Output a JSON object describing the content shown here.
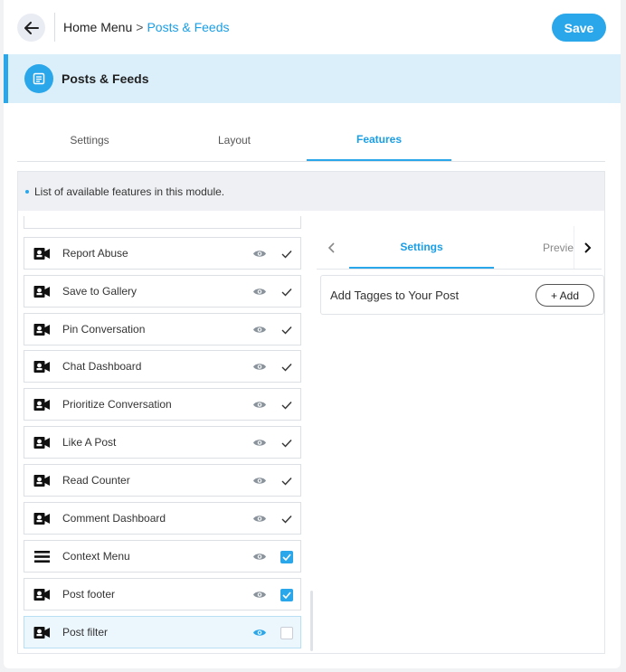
{
  "header": {
    "breadcrumb_home": "Home Menu",
    "breadcrumb_sep": ">",
    "breadcrumb_current": "Posts & Feeds",
    "save_label": "Save"
  },
  "module": {
    "title": "Posts & Feeds",
    "icon": "document-icon"
  },
  "tabs": [
    {
      "label": "Settings",
      "active": false
    },
    {
      "label": "Layout",
      "active": false
    },
    {
      "label": "Features",
      "active": true
    }
  ],
  "info_text": "List of available features in this module.",
  "features": [
    {
      "label": "Report Abuse",
      "icon": "video-icon",
      "visible": true,
      "state": "check"
    },
    {
      "label": "Save to Gallery",
      "icon": "video-icon",
      "visible": true,
      "state": "check"
    },
    {
      "label": "Pin Conversation",
      "icon": "video-icon",
      "visible": true,
      "state": "check"
    },
    {
      "label": "Chat Dashboard",
      "icon": "video-icon",
      "visible": true,
      "state": "check"
    },
    {
      "label": "Prioritize Conversation",
      "icon": "video-icon",
      "visible": true,
      "state": "check"
    },
    {
      "label": "Like A Post",
      "icon": "video-icon",
      "visible": true,
      "state": "check"
    },
    {
      "label": "Read Counter",
      "icon": "video-icon",
      "visible": true,
      "state": "check"
    },
    {
      "label": "Comment Dashboard",
      "icon": "video-icon",
      "visible": true,
      "state": "check"
    },
    {
      "label": "Context Menu",
      "icon": "menu-icon",
      "visible": true,
      "state": "checked"
    },
    {
      "label": "Post footer",
      "icon": "video-icon",
      "visible": true,
      "state": "checked"
    },
    {
      "label": "Post filter",
      "icon": "video-icon",
      "visible": true,
      "state": "unchecked",
      "highlighted": true
    }
  ],
  "right_panel": {
    "tabs": [
      {
        "label": "Settings",
        "active": true
      },
      {
        "label": "Previe",
        "active": false
      }
    ],
    "setting_label": "Add Tagges to Your Post",
    "add_label": "+ Add"
  },
  "colors": {
    "accent": "#2aa6ea",
    "header_bg": "#dbeffb",
    "icon_gray": "#8a939c"
  }
}
